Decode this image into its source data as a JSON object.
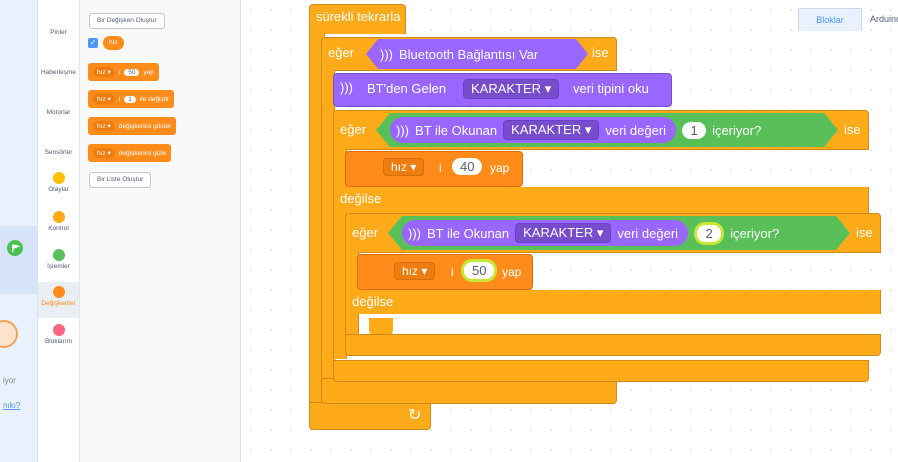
{
  "tabs": {
    "blocks": "Bloklar",
    "arduino": "Arduino"
  },
  "categories": [
    {
      "label": "Pinler",
      "color": ""
    },
    {
      "label": "Haberleşme",
      "color": ""
    },
    {
      "label": "Motorlar",
      "color": ""
    },
    {
      "label": "Sensörler",
      "color": ""
    },
    {
      "label": "Olaylar",
      "color": "#ffbf00"
    },
    {
      "label": "Kontrol",
      "color": "#ffab19"
    },
    {
      "label": "İşlemler",
      "color": "#59c059"
    },
    {
      "label": "Değişkenler",
      "color": "#ff8c1a"
    },
    {
      "label": "Bloklarım",
      "color": "#ff6680"
    }
  ],
  "flyout": {
    "make_variable": "Bir Değişken Oluştur",
    "variable_name": "hız",
    "blocks": [
      {
        "var": "hız",
        "label": "i",
        "value": "50",
        "suffix": "yap"
      },
      {
        "var": "hız",
        "label": "i",
        "value": "1",
        "suffix": "ile değiştir"
      },
      {
        "var": "hız",
        "label": "değişkenini göster",
        "value": "",
        "suffix": ""
      },
      {
        "var": "hız",
        "label": "değişkenini gizle",
        "value": "",
        "suffix": ""
      }
    ],
    "make_list": "Bir Liste Oluştur"
  },
  "stage": {
    "text1": "iyor",
    "text2": "nıkı?"
  },
  "script": {
    "forever": "sürekli tekrarla",
    "if1": {
      "if": "eğer",
      "cond": "Bluetooth Bağlantısı Var",
      "then": "ise"
    },
    "read": {
      "prefix": "BT'den Gelen",
      "type": "KARAKTER",
      "suffix": "veri tipini oku"
    },
    "if2": {
      "if": "eğer",
      "prefix": "BT ile Okunan",
      "type": "KARAKTER",
      "mid": "veri değeri",
      "value": "1",
      "contains": "içeriyor?",
      "then": "ise"
    },
    "set1": {
      "var": "hız",
      "label": "i",
      "value": "40",
      "suffix": "yap"
    },
    "else1": "değilse",
    "if3": {
      "if": "eğer",
      "prefix": "BT ile Okunan",
      "type": "KARAKTER",
      "mid": "veri değeri",
      "value": "2",
      "contains": "içeriyor?",
      "then": "ise"
    },
    "set2": {
      "var": "hız",
      "label": "i",
      "value": "50",
      "suffix": "yap"
    },
    "else2": "değilse"
  }
}
